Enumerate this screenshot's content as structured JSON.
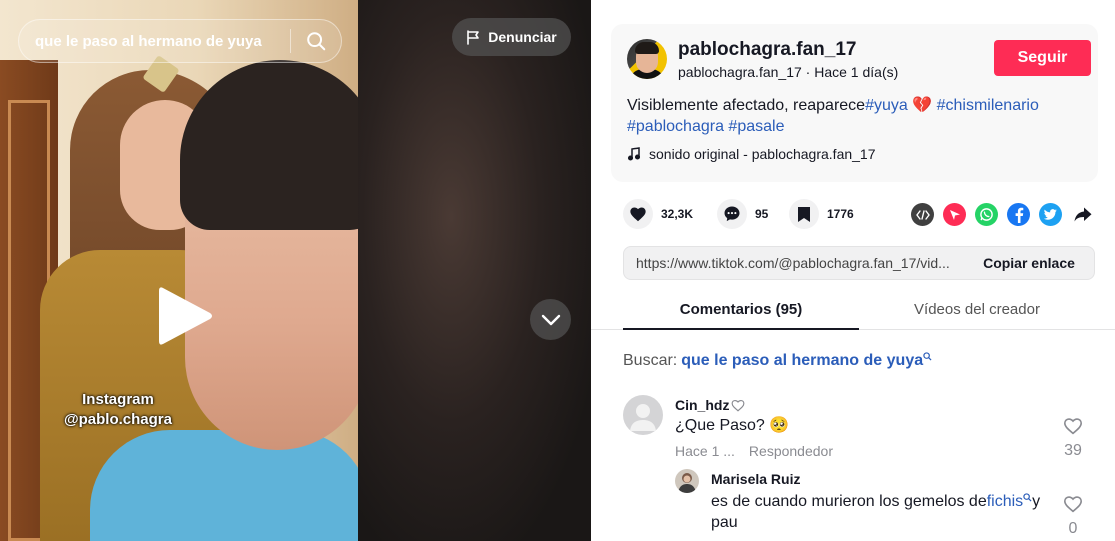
{
  "video": {
    "search_query": "que le paso al hermano de yuya",
    "report_label": "Denunciar",
    "watermark_line1": "Instagram",
    "watermark_line2": "@pablo.chagra"
  },
  "author": {
    "username": "pablochagra.fan_17",
    "handle": "pablochagra.fan_17",
    "separator": "·",
    "posted": "Hace 1 día(s)",
    "follow_label": "Seguir"
  },
  "caption": {
    "text": "Visiblemente afectado, reaparece",
    "hashtags": [
      "#yuya",
      "#chismilenario",
      "#pablochagra",
      "#pasale"
    ],
    "emoji": "💔"
  },
  "music": {
    "label": "sonido original - pablochagra.fan_17"
  },
  "stats": {
    "likes": "32,3K",
    "comments": "95",
    "saves": "1776"
  },
  "share": {
    "link": "https://www.tiktok.com/@pablochagra.fan_17/vid...",
    "copy_label": "Copiar enlace"
  },
  "tabs": {
    "comments": "Comentarios (95)",
    "creator_videos": "Vídeos del creador"
  },
  "related_search": {
    "label": "Buscar:",
    "query": "que le paso al hermano de yuya"
  },
  "comments": [
    {
      "user": "Cin_hdz",
      "text": "¿Que Paso? 🥺",
      "time": "Hace 1 ...",
      "reply_label": "Respondedor",
      "likes": "39"
    }
  ],
  "replies": [
    {
      "user": "Marisela Ruiz",
      "text_before": "es de cuando murieron los gemelos de",
      "link": "fichis",
      "text_after": "y",
      "text_line2": "pau",
      "likes": "0"
    }
  ],
  "colors": {
    "accent": "#fe2c55",
    "link": "#2b5db9",
    "whatsapp": "#25d366",
    "facebook": "#1877f2",
    "twitter": "#1da1f2",
    "embed": "#404040",
    "send": "#fe2c55"
  },
  "icons": [
    "search-icon",
    "flag-icon",
    "play-icon",
    "chevron-down-icon",
    "music-note-icon",
    "heart-icon",
    "comment-icon",
    "bookmark-icon",
    "embed-icon",
    "send-icon",
    "whatsapp-icon",
    "facebook-icon",
    "twitter-icon",
    "share-arrow-icon",
    "search-small-icon"
  ]
}
